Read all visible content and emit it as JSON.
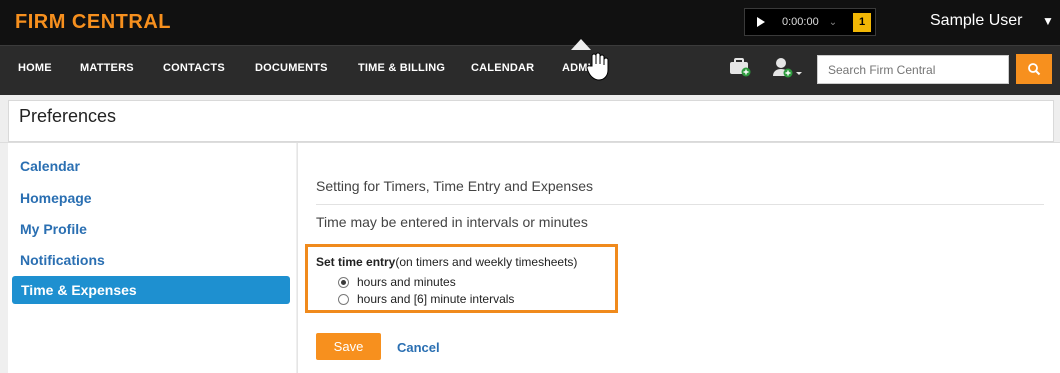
{
  "brand": "FIRM CENTRAL",
  "timer": {
    "time": "0:00:00",
    "count": "1"
  },
  "user": {
    "name": "Sample User"
  },
  "nav": {
    "items": [
      "HOME",
      "MATTERS",
      "CONTACTS",
      "DOCUMENTS",
      "TIME & BILLING",
      "CALENDAR",
      "ADMIN"
    ],
    "active": "ADMIN"
  },
  "search": {
    "placeholder": "Search Firm Central"
  },
  "page": {
    "title": "Preferences"
  },
  "sidebar": {
    "items": [
      "Calendar",
      "Homepage",
      "My Profile",
      "Notifications",
      "Time & Expenses"
    ],
    "active": "Time & Expenses"
  },
  "main": {
    "section_title": "Setting for Timers, Time Entry and Expenses",
    "description": "Time may be entered in intervals or minutes",
    "set_time_entry": {
      "label_bold": "Set time entry",
      "label_rest": "(on timers and weekly timesheets)",
      "options": [
        {
          "label": "hours and minutes",
          "checked": true
        },
        {
          "label": "hours and [6] minute intervals",
          "checked": false
        }
      ]
    },
    "save_label": "Save",
    "cancel_label": "Cancel"
  },
  "colors": {
    "accent": "#f7901e",
    "link": "#2a6fb2",
    "active_nav_bg": "#1e90d0",
    "highlight_border": "#f08a1c"
  }
}
